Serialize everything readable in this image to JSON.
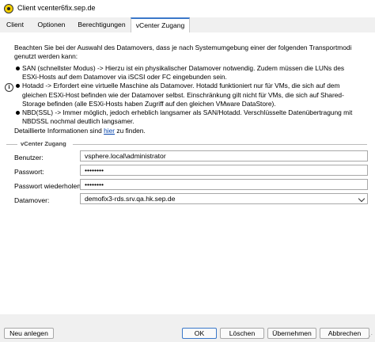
{
  "window": {
    "title": "Client vcenter6fix.sep.de"
  },
  "tabs": [
    {
      "label": "Client"
    },
    {
      "label": "Optionen"
    },
    {
      "label": "Berechtigungen"
    },
    {
      "label": "vCenter Zugang"
    }
  ],
  "info": {
    "intro": "Beachten Sie bei der Auswahl des Datamovers, dass je nach Systemumgebung einer der folgenden Transportmodi genutzt werden kann:",
    "bullets": [
      "SAN (schnellster Modus) -> Hierzu ist ein physikalischer Datamover notwendig. Zudem müssen die LUNs des ESXi-Hosts auf dem Datamover via iSCSI oder FC eingebunden sein.",
      "Hotadd -> Erfordert eine virtuelle Maschine als Datamover. Hotadd funktioniert nur für VMs, die sich auf dem gleichen ESXi-Host befinden wie der Datamover selbst. Einschränkung gilt nicht für VMs, die sich auf Shared-Storage befinden (alle ESXi-Hosts haben Zugriff auf den gleichen VMware DataStore).",
      "NBD(SSL) -> Immer möglich, jedoch erheblich langsamer als SAN/Hotadd. Verschlüsselte Datenübertragung mit NBDSSL nochmal deutlich langsamer."
    ],
    "more_prefix": "Detaillierte Informationen sind ",
    "more_link": "hier",
    "more_suffix": " zu finden."
  },
  "vcenter": {
    "group_title": "vCenter Zugang",
    "user_label": "Benutzer:",
    "user_value": "vsphere.local\\administrator",
    "password_label": "Passwort:",
    "password_value": "••••••••",
    "repeat_label": "Passwort wiederholen:",
    "repeat_value": "••••••••",
    "datamover_label": "Datamover:",
    "datamover_value": "demofix3-rds.srv.qa.hk.sep.de"
  },
  "buttons": {
    "new": "Neu anlegen",
    "ok": "OK",
    "delete": "Löschen",
    "apply": "Übernehmen",
    "cancel": "Abbrechen"
  }
}
